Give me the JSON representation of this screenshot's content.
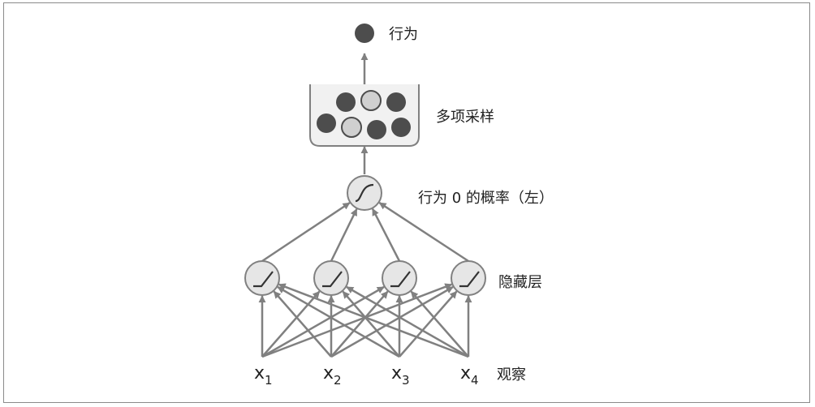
{
  "labels": {
    "action": "行为",
    "multinomial": "多项采样",
    "probability": "行为 0 的概率（左）",
    "hidden": "隐藏层",
    "observation": "观察"
  },
  "inputs": [
    {
      "base": "x",
      "sub": "1"
    },
    {
      "base": "x",
      "sub": "2"
    },
    {
      "base": "x",
      "sub": "3"
    },
    {
      "base": "x",
      "sub": "4"
    }
  ],
  "colors": {
    "line": "#808080",
    "node_fill": "#e6e6e6",
    "dark_ball": "#4d4d4d",
    "light_ball": "#d0d0d0"
  }
}
